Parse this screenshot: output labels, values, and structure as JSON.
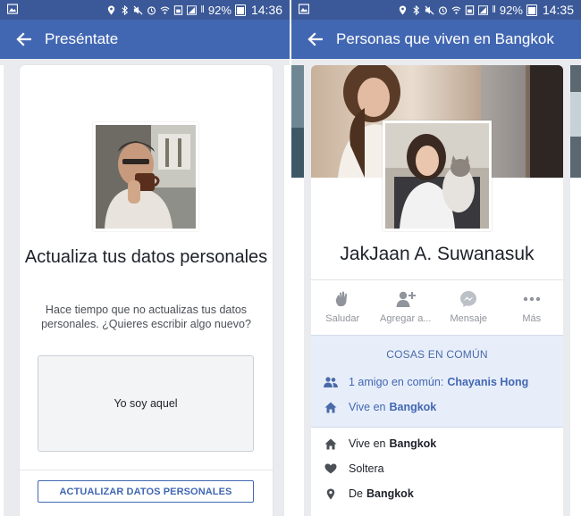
{
  "left": {
    "status": {
      "battery": "92%",
      "time": "14:36"
    },
    "appbar": {
      "title": "Preséntate"
    },
    "heading": "Actualiza tus datos personales",
    "description": "Hace tiempo que no actualizas tus datos personales. ¿Quieres escribir algo nuevo?",
    "textbox_value": "Yo soy aquel",
    "button_label": "ACTUALIZAR DATOS PERSONALES"
  },
  "right": {
    "status": {
      "battery": "92%",
      "time": "14:35"
    },
    "appbar": {
      "title": "Personas que viven en Bangkok"
    },
    "profile_name": "JakJaan A. Suwanasuk",
    "actions": [
      {
        "label": "Saludar",
        "icon": "wave-icon"
      },
      {
        "label": "Agregar a...",
        "icon": "add-friend-icon"
      },
      {
        "label": "Mensaje",
        "icon": "messenger-icon"
      },
      {
        "label": "Más",
        "icon": "more-icon"
      }
    ],
    "common": {
      "title": "COSAS EN COMÚN",
      "mutual_prefix": "1 amigo en común:",
      "mutual_name": "Chayanis Hong",
      "lives_prefix": "Vive en",
      "lives_city": "Bangkok"
    },
    "info": {
      "lives_prefix": "Vive en",
      "lives_city": "Bangkok",
      "relationship": "Soltera",
      "from_prefix": "De",
      "from_city": "Bangkok"
    }
  },
  "colors": {
    "status_bar": "#3b5998",
    "app_bar": "#4267b2",
    "accent": "#4267b2",
    "common_bg": "#e7eefa"
  }
}
